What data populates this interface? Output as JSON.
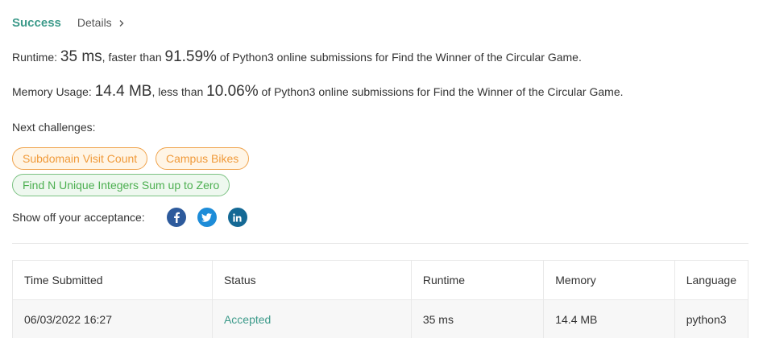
{
  "header": {
    "status": "Success",
    "details_label": "Details"
  },
  "runtime": {
    "label": "Runtime: ",
    "value": "35 ms",
    "mid": ", faster than ",
    "percent": "91.59%",
    "suffix": " of Python3 online submissions for Find the Winner of the Circular Game."
  },
  "memory": {
    "label": "Memory Usage: ",
    "value": "14.4 MB",
    "mid": ", less than ",
    "percent": "10.06%",
    "suffix": " of Python3 online submissions for Find the Winner of the Circular Game."
  },
  "next": {
    "label": "Next challenges:",
    "challenges": [
      {
        "label": "Subdomain Visit Count",
        "color": "orange"
      },
      {
        "label": "Campus Bikes",
        "color": "orange"
      },
      {
        "label": "Find N Unique Integers Sum up to Zero",
        "color": "green"
      }
    ]
  },
  "share": {
    "label": "Show off your acceptance:",
    "icons": [
      "facebook-icon",
      "twitter-icon",
      "linkedin-icon"
    ]
  },
  "table": {
    "headers": [
      "Time Submitted",
      "Status",
      "Runtime",
      "Memory",
      "Language"
    ],
    "rows": [
      [
        "06/03/2022 16:27",
        "Accepted",
        "35 ms",
        "14.4 MB",
        "python3"
      ]
    ]
  },
  "colors": {
    "success": "#3c9a8a",
    "orange": "#f09a3a",
    "green": "#4caf50"
  }
}
